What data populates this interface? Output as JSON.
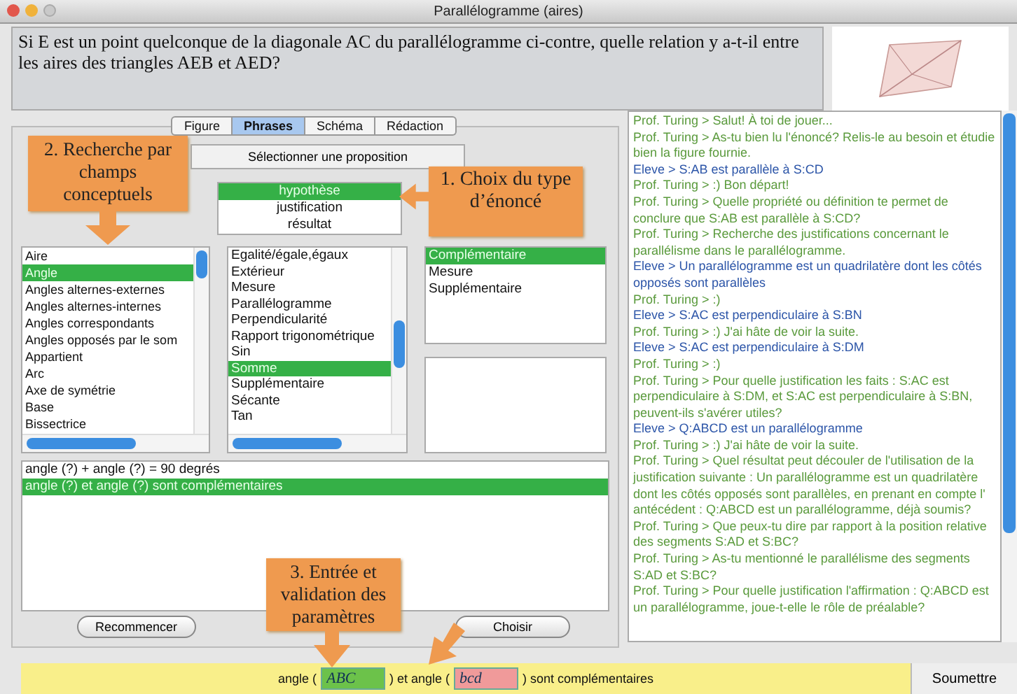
{
  "window": {
    "title": "Parallélogramme (aires)"
  },
  "question": "Si E est un point quelconque de la diagonale AC du parallélogramme ci-contre, quelle relation y a-t-il entre les aires des triangles AEB et AED?",
  "tabs": [
    {
      "label": "Figure",
      "selected": false
    },
    {
      "label": "Phrases",
      "selected": true
    },
    {
      "label": "Schéma",
      "selected": false
    },
    {
      "label": "Rédaction",
      "selected": false
    }
  ],
  "select_button": "Sélectionner une proposition",
  "statement_types": [
    {
      "label": "hypothèse",
      "selected": true
    },
    {
      "label": "justification",
      "selected": false
    },
    {
      "label": "résultat",
      "selected": false
    }
  ],
  "concepts": [
    {
      "label": "Aire",
      "selected": false
    },
    {
      "label": "Angle",
      "selected": true
    },
    {
      "label": "Angles alternes-externes",
      "selected": false
    },
    {
      "label": "Angles alternes-internes",
      "selected": false
    },
    {
      "label": "Angles correspondants",
      "selected": false
    },
    {
      "label": "Angles opposés par le som",
      "selected": false
    },
    {
      "label": "Appartient",
      "selected": false
    },
    {
      "label": "Arc",
      "selected": false
    },
    {
      "label": "Axe de symétrie",
      "selected": false
    },
    {
      "label": "Base",
      "selected": false
    },
    {
      "label": "Bissectrice",
      "selected": false
    }
  ],
  "sub_concepts": [
    {
      "label": "Egalité/égale,égaux",
      "selected": false
    },
    {
      "label": "Extérieur",
      "selected": false
    },
    {
      "label": "Mesure",
      "selected": false
    },
    {
      "label": "Parallélogramme",
      "selected": false
    },
    {
      "label": "Perpendicularité",
      "selected": false
    },
    {
      "label": "Rapport trigonométrique",
      "selected": false
    },
    {
      "label": "Sin",
      "selected": false
    },
    {
      "label": "Somme",
      "selected": true
    },
    {
      "label": "Supplémentaire",
      "selected": false
    },
    {
      "label": "Sécante",
      "selected": false
    },
    {
      "label": "Tan",
      "selected": false
    }
  ],
  "properties": [
    {
      "label": "Complémentaire",
      "selected": true
    },
    {
      "label": "Mesure",
      "selected": false
    },
    {
      "label": "Supplémentaire",
      "selected": false
    }
  ],
  "propositions": [
    {
      "label": "angle (?) + angle (?) = 90 degrés",
      "selected": false
    },
    {
      "label": "angle (?) et angle (?) sont complémentaires",
      "selected": true
    }
  ],
  "buttons": [
    "Recommencer",
    "Choisir"
  ],
  "callouts": [
    {
      "text": "2. Recherche par champs conceptuels"
    },
    {
      "text": "1. Choix du type d’énoncé"
    },
    {
      "text": "3. Entrée et validation des paramètres"
    }
  ],
  "chat": [
    {
      "kind": "prof",
      "text": "Prof. Turing >  Salut! À toi de jouer..."
    },
    {
      "kind": "prof",
      "text": "Prof. Turing >  As-tu bien lu l'énoncé? Relis-le au besoin et étudie bien la figure fournie."
    },
    {
      "kind": "eleve",
      "text": "Eleve >  S:AB est parallèle à S:CD"
    },
    {
      "kind": "prof",
      "text": "Prof. Turing >  :)  Bon départ!"
    },
    {
      "kind": "prof",
      "text": "Prof. Turing >  Quelle propriété ou définition te permet de conclure que S:AB est parallèle à S:CD?"
    },
    {
      "kind": "prof",
      "text": "Prof. Turing >  Recherche des justifications concernant le parallélisme dans le parallélogramme."
    },
    {
      "kind": "eleve",
      "text": "Eleve >  Un parallélogramme est un quadrilatère dont les côtés opposés sont parallèles"
    },
    {
      "kind": "prof",
      "text": "Prof. Turing >  :)"
    },
    {
      "kind": "eleve",
      "text": "Eleve >  S:AC est perpendiculaire à S:BN"
    },
    {
      "kind": "prof",
      "text": "Prof. Turing >  :)  J'ai hâte de voir la suite."
    },
    {
      "kind": "eleve",
      "text": "Eleve >  S:AC est perpendiculaire à S:DM"
    },
    {
      "kind": "prof",
      "text": "Prof. Turing >  :)"
    },
    {
      "kind": "prof",
      "text": "Prof. Turing >  Pour quelle justification les faits : S:AC est perpendiculaire à S:DM, et S:AC est perpendiculaire à S:BN, peuvent-ils s'avérer utiles?"
    },
    {
      "kind": "eleve",
      "text": "Eleve >  Q:ABCD est un parallélogramme"
    },
    {
      "kind": "prof",
      "text": "Prof. Turing >  :)  J'ai hâte de voir la suite."
    },
    {
      "kind": "prof",
      "text": "Prof. Turing >  Quel résultat peut découler de l'utilisation de la justification suivante : Un parallélogramme est un quadrilatère dont les côtés opposés sont parallèles, en prenant en compte l' antécédent : Q:ABCD est un parallélogramme, déjà soumis?"
    },
    {
      "kind": "prof",
      "text": "Prof. Turing >  Que peux-tu dire par rapport à la position relative des segments S:AD et S:BC?"
    },
    {
      "kind": "prof",
      "text": "Prof. Turing >  As-tu mentionné le parallélisme des segments S:AD et S:BC?"
    },
    {
      "kind": "prof",
      "text": "Prof. Turing >  Pour quelle justification l'affirmation : Q:ABCD est un parallélogramme, joue-t-elle le rôle de préalable?"
    }
  ],
  "entry": [
    {
      "kind": "text",
      "text": "angle ("
    },
    {
      "kind": "field",
      "value": "ABC",
      "valid": true
    },
    {
      "kind": "text",
      "text": ") et angle ("
    },
    {
      "kind": "field",
      "value": "bcd",
      "valid": false
    },
    {
      "kind": "text",
      "text": ") sont complémentaires"
    }
  ],
  "submit_button": "Soumettre"
}
